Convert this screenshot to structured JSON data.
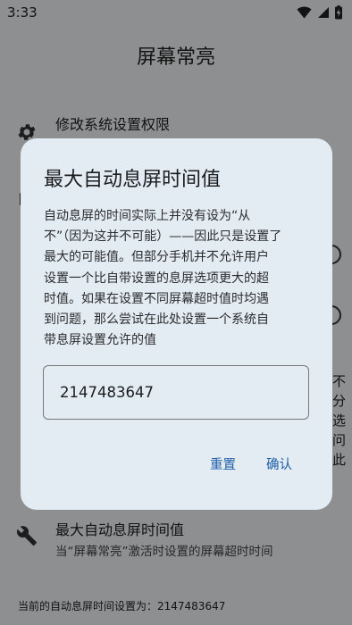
{
  "status_bar": {
    "time": "3:33",
    "icons": [
      "wifi-icon",
      "signal-icon",
      "battery-charging-icon"
    ]
  },
  "app": {
    "title": "屏幕常亮"
  },
  "settings": [
    {
      "icon": "gear-icon",
      "title": "修改系统设置权限"
    },
    {
      "icon": "wrench-icon",
      "title": "最大自动息屏时间值",
      "subtitle": "当“屏幕常亮”激活时设置的屏幕超时时间"
    }
  ],
  "background_peek": {
    "right_chars": [
      "不",
      "分",
      "选",
      "问",
      "此"
    ]
  },
  "footer": {
    "current_timeout_text": "当前的自动息屏时间设置为：2147483647"
  },
  "dialog": {
    "title": "最大自动息屏时间值",
    "body_lines": [
      "自动息屏的时间实际上并没有设为“从",
      "不”（因为这并不可能）——因此只是设置了",
      "最大的可能值。但部分手机并不允许用户",
      "设置一个比自带设置的息屏选项更大的超",
      "时值。如果在设置不同屏幕超时值时均遇",
      "到问题，那么尝试在此处设置一个系统自",
      "带息屏设置允许的值"
    ],
    "input_value": "2147483647",
    "reset_label": "重置",
    "confirm_label": "确认"
  },
  "colors": {
    "dialog_background": "#e3ebf3",
    "accent": "#1f5fa8",
    "scrim": "rgba(0,0,0,0.42)"
  }
}
